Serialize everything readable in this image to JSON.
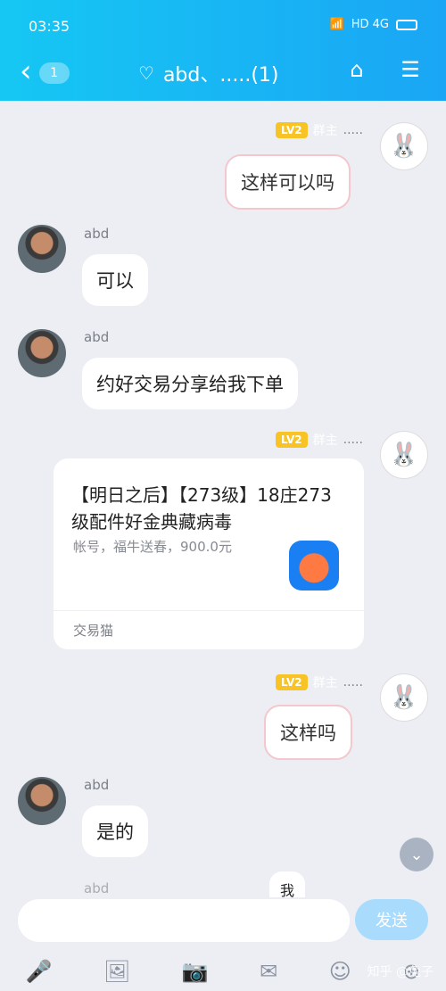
{
  "status": {
    "time": "03:35",
    "network": "HD 4G"
  },
  "header": {
    "back_count": "1",
    "title": "abd、.....(1)"
  },
  "tags": {
    "level": "LV2",
    "owner": "群主",
    "dots": "....."
  },
  "messages": [
    {
      "from": "owner",
      "text": "这样可以吗"
    },
    {
      "from": "abd",
      "name": "abd",
      "text": "可以"
    },
    {
      "from": "abd",
      "name": "abd",
      "text": "约好交易分享给我下单"
    },
    {
      "from": "owner",
      "card": {
        "title": "【明日之后】【273级】18庄273级配件好金典藏病毒",
        "subtitle": "帐号，福牛送春，900.0元",
        "source": "交易猫"
      }
    },
    {
      "from": "owner",
      "text": "这样吗"
    },
    {
      "from": "abd",
      "name": "abd",
      "text": "是的"
    }
  ],
  "partial": {
    "name": "abd",
    "bubble": "我"
  },
  "input": {
    "placeholder": "",
    "send_label": "发送"
  },
  "icons": {
    "back": "chevron-left-icon",
    "ear": "ear-icon",
    "tag": "tag-icon",
    "menu": "hamburger-icon",
    "scroll": "chevron-down-icon",
    "mic": "microphone-icon",
    "image": "image-icon",
    "camera": "camera-icon",
    "redpacket": "red-packet-icon",
    "emoji": "emoji-icon",
    "plus": "plus-icon"
  },
  "watermark": "知乎 @兔子"
}
